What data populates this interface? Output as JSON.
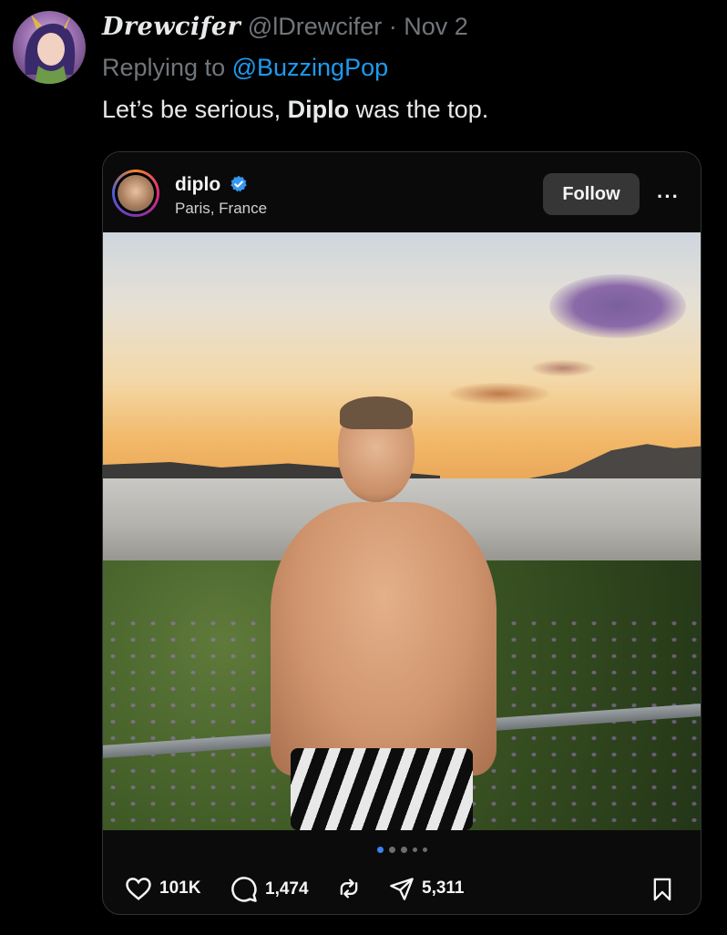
{
  "tweet": {
    "display_name": "Drewcifer",
    "handle": "@lDrewcifer",
    "separator": "·",
    "date": "Nov 2",
    "replying_label": "Replying to",
    "replying_to": "@BuzzingPop",
    "text_before": "Let’s be serious, ",
    "text_bold": "Diplo",
    "text_after": " was the top."
  },
  "embed": {
    "username": "diplo",
    "location": "Paris, France",
    "follow_label": "Follow",
    "more_label": "···",
    "likes": "101K",
    "comments": "1,474",
    "shares": "5,311",
    "carousel": {
      "total": 5,
      "active_index": 0
    }
  },
  "colors": {
    "background": "#000000",
    "accent": "#1d9bf0",
    "muted": "#71767b",
    "verified": "#3897f0"
  },
  "icons": [
    "heart-icon",
    "comment-icon",
    "repost-icon",
    "share-icon",
    "bookmark-icon",
    "verified-icon"
  ]
}
